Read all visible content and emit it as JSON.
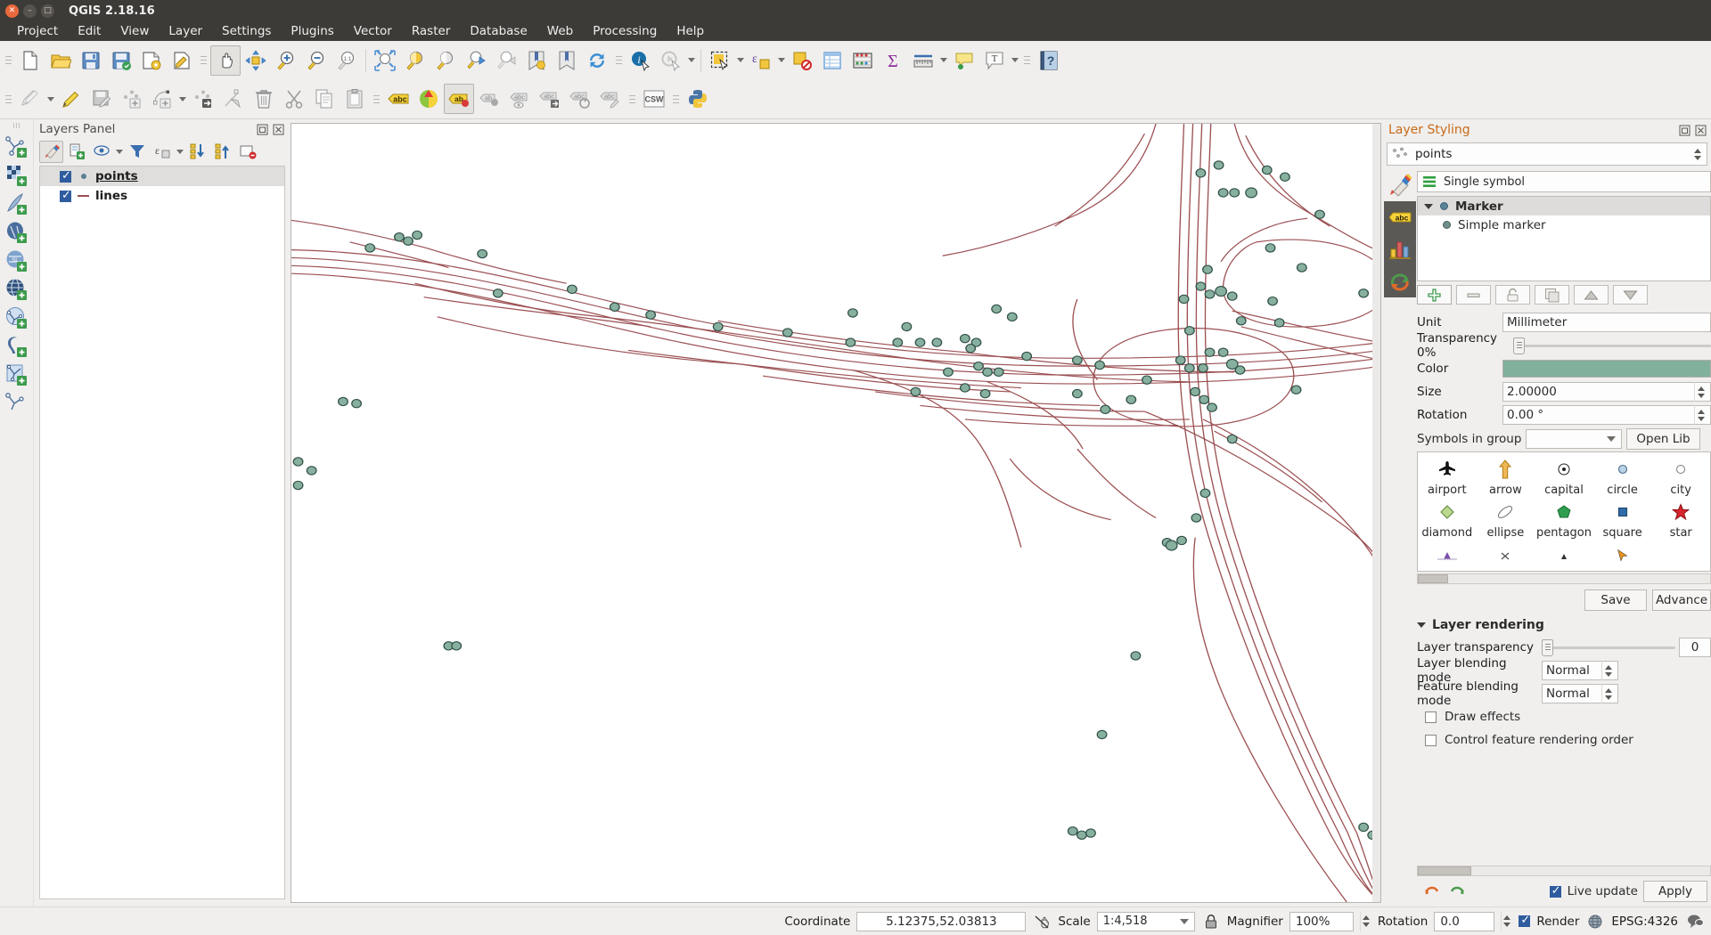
{
  "window": {
    "title": "QGIS 2.18.16",
    "close_icon": "close-icon",
    "minimize_icon": "minimize-icon",
    "maximize_icon": "maximize-icon"
  },
  "menubar": {
    "items": [
      "Project",
      "Edit",
      "View",
      "Layer",
      "Settings",
      "Plugins",
      "Vector",
      "Raster",
      "Database",
      "Web",
      "Processing",
      "Help"
    ]
  },
  "toolbar_row1": [
    {
      "name": "new-project-icon"
    },
    {
      "name": "open-project-icon"
    },
    {
      "name": "save-project-icon"
    },
    {
      "name": "save-project-as-icon"
    },
    {
      "name": "new-print-composer-icon"
    },
    {
      "name": "composer-manager-icon"
    },
    {
      "name": "pan-map-icon",
      "active": true
    },
    {
      "name": "pan-to-selection-icon"
    },
    {
      "name": "zoom-in-icon"
    },
    {
      "name": "zoom-out-icon"
    },
    {
      "name": "zoom-native-icon"
    },
    {
      "name": "zoom-full-icon"
    },
    {
      "name": "zoom-to-selection-icon"
    },
    {
      "name": "zoom-to-layer-icon"
    },
    {
      "name": "zoom-last-icon"
    },
    {
      "name": "zoom-next-icon"
    },
    {
      "name": "refresh-bookmark-icon"
    },
    {
      "name": "new-bookmark-icon"
    },
    {
      "name": "refresh-icon"
    },
    {
      "name": "identify-features-icon"
    },
    {
      "name": "run-feature-action-icon"
    },
    {
      "name": "select-features-icon"
    },
    {
      "name": "select-by-expression-icon"
    },
    {
      "name": "deselect-features-icon"
    },
    {
      "name": "open-attribute-table-icon"
    },
    {
      "name": "field-calculator-icon"
    },
    {
      "name": "statistical-summary-icon"
    },
    {
      "name": "measure-line-icon"
    },
    {
      "name": "map-tips-icon"
    },
    {
      "name": "text-annotation-icon"
    },
    {
      "name": "help-contents-icon"
    }
  ],
  "toolbar_row2": [
    {
      "name": "current-edits-icon"
    },
    {
      "name": "toggle-editing-icon"
    },
    {
      "name": "save-layer-edits-icon"
    },
    {
      "name": "add-point-feature-icon"
    },
    {
      "name": "add-line-feature-icon"
    },
    {
      "name": "move-feature-icon"
    },
    {
      "name": "node-tool-icon"
    },
    {
      "name": "delete-selected-icon"
    },
    {
      "name": "cut-features-icon"
    },
    {
      "name": "copy-features-icon"
    },
    {
      "name": "paste-features-icon"
    },
    {
      "name": "label-icon"
    },
    {
      "name": "style-manager-icon"
    },
    {
      "name": "layer-labeling-options-icon"
    },
    {
      "name": "pin-labels-icon"
    },
    {
      "name": "show-hide-labels-icon"
    },
    {
      "name": "move-label-icon"
    },
    {
      "name": "rotate-label-icon"
    },
    {
      "name": "change-label-icon"
    },
    {
      "name": "metasearch-csw-icon"
    },
    {
      "name": "python-console-icon"
    }
  ],
  "left_toolbar": [
    {
      "name": "add-vector-layer-icon"
    },
    {
      "name": "add-raster-layer-icon"
    },
    {
      "name": "add-delimited-text-layer-icon"
    },
    {
      "name": "add-postgis-layer-icon"
    },
    {
      "name": "add-spatialite-layer-icon"
    },
    {
      "name": "add-wms-layer-icon"
    },
    {
      "name": "add-mssql-layer-icon"
    },
    {
      "name": "add-oracle-layer-icon"
    },
    {
      "name": "add-db2-layer-icon"
    },
    {
      "name": "add-wcs-layer-icon"
    }
  ],
  "layers_panel": {
    "title": "Layers Panel",
    "dock_icon": "undock-icon",
    "close_icon": "close-icon",
    "toolbar": [
      {
        "name": "open-layer-styling-panel-icon",
        "selected": true
      },
      {
        "name": "add-group-icon"
      },
      {
        "name": "manage-map-themes-icon",
        "caret": true
      },
      {
        "name": "filter-legend-icon"
      },
      {
        "name": "filter-legend-by-expression-icon",
        "caret": true
      },
      {
        "name": "expand-all-icon"
      },
      {
        "name": "collapse-all-icon"
      },
      {
        "name": "remove-layer-icon"
      }
    ],
    "layers": [
      {
        "name": "points",
        "checked": true,
        "symbol": "point",
        "selected": true
      },
      {
        "name": "lines",
        "checked": true,
        "symbol": "line",
        "selected": false
      }
    ]
  },
  "styling_panel": {
    "title": "Layer Styling",
    "dock_icon": "undock-icon",
    "close_icon": "close-icon",
    "layer_selector": {
      "value": "points",
      "icon": "point-layer-icon"
    },
    "tabs": [
      {
        "name": "symbology-tab",
        "icon": "paintbrush-icon",
        "active": true
      },
      {
        "name": "labels-tab",
        "icon": "abc-label-icon"
      },
      {
        "name": "3d-view-tab",
        "icon": "diagram-icon"
      },
      {
        "name": "history-tab",
        "icon": "undo-history-icon"
      }
    ],
    "renderer": {
      "value": "Single symbol",
      "icon": "single-symbol-icon"
    },
    "symbol_tree": {
      "root": {
        "label": "Marker",
        "icon": "marker-dot-icon"
      },
      "children": [
        {
          "label": "Simple marker",
          "icon": "marker-dot-icon"
        }
      ]
    },
    "symbol_buttons": [
      {
        "name": "add-symbol-layer-button",
        "icon": "plus-icon"
      },
      {
        "name": "remove-symbol-layer-button",
        "icon": "minus-icon"
      },
      {
        "name": "lock-symbol-layer-button",
        "icon": "lock-icon"
      },
      {
        "name": "duplicate-symbol-layer-button",
        "icon": "duplicate-icon"
      },
      {
        "name": "move-up-button",
        "icon": "triangle-up-icon"
      },
      {
        "name": "move-down-button",
        "icon": "triangle-down-icon"
      }
    ],
    "properties": {
      "unit_label": "Unit",
      "unit_value": "Millimeter",
      "transparency_label": "Transparency 0%",
      "color_label": "Color",
      "color_value": "#81b09c",
      "size_label": "Size",
      "size_value": "2.00000",
      "rotation_label": "Rotation",
      "rotation_value": "0.00 °"
    },
    "symbols_group": {
      "label": "Symbols in group",
      "value": "",
      "open_library_button": "Open Lib"
    },
    "gallery": [
      {
        "label": "airport",
        "icon": "airport-symbol-icon"
      },
      {
        "label": "arrow",
        "icon": "arrow-symbol-icon"
      },
      {
        "label": "capital",
        "icon": "capital-symbol-icon"
      },
      {
        "label": "circle",
        "icon": "circle-symbol-icon"
      },
      {
        "label": "city",
        "icon": "city-symbol-icon"
      },
      {
        "label": "diamond",
        "icon": "diamond-symbol-icon"
      },
      {
        "label": "ellipse",
        "icon": "ellipse-symbol-icon"
      },
      {
        "label": "pentagon",
        "icon": "pentagon-symbol-icon"
      },
      {
        "label": "square",
        "icon": "square-symbol-icon"
      },
      {
        "label": "star",
        "icon": "star-symbol-icon"
      }
    ],
    "save_button": "Save",
    "advanced_button": "Advance",
    "layer_rendering": {
      "title": "Layer rendering",
      "transparency_label": "Layer transparency",
      "transparency_value": "0",
      "layer_blending_label": "Layer blending mode",
      "layer_blending_value": "Normal",
      "feature_blending_label": "Feature blending mode",
      "feature_blending_value": "Normal",
      "draw_effects_label": "Draw effects",
      "draw_effects_checked": false,
      "control_order_label": "Control feature rendering order",
      "control_order_checked": false
    },
    "footer": {
      "undo_icon": "undo-icon",
      "redo_icon": "redo-icon",
      "live_update_label": "Live update",
      "live_update_checked": true,
      "apply_button": "Apply"
    }
  },
  "statusbar": {
    "coordinate_label": "Coordinate",
    "coordinate_value": "5.12375,52.03813",
    "toggle_extents_icon": "toggle-extents-icon",
    "scale_label": "Scale",
    "scale_value": "1:4,518",
    "scale_lock_icon": "lock-scale-icon",
    "magnifier_label": "Magnifier",
    "magnifier_value": "100%",
    "rotation_label": "Rotation",
    "rotation_value": "0.0",
    "render_label": "Render",
    "render_checked": true,
    "crs_label": "EPSG:4326",
    "crs_icon": "crs-globe-icon",
    "messages_icon": "messages-icon"
  },
  "map": {
    "point_fill": "#87b09e",
    "point_stroke": "#2f4f47",
    "line_stroke": "#9b4f52",
    "background": "#ffffff"
  }
}
